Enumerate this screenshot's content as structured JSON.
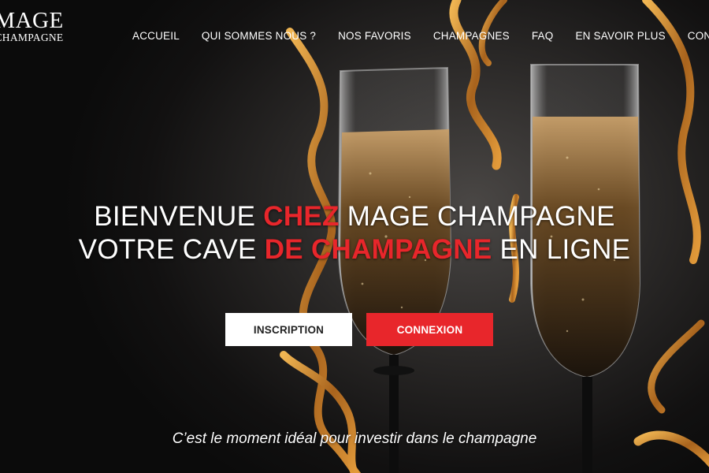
{
  "logo": {
    "line1": "MAGE",
    "line2": "CHAMPAGNE"
  },
  "nav": {
    "items": [
      "ACCUEIL",
      "QUI SOMMES NOUS ?",
      "NOS FAVORIS",
      "CHAMPAGNES",
      "FAQ",
      "EN SAVOIR PLUS",
      "CONTACT"
    ]
  },
  "hero": {
    "line1": {
      "a": "BIENVENUE ",
      "b": "CHEZ",
      "c": " MAGE CHAMPAGNE"
    },
    "line2": {
      "a": "VOTRE CAVE ",
      "b": "DE CHAMPAGNE",
      "c": " EN LIGNE"
    },
    "btn_inscription": "INSCRIPTION",
    "btn_connexion": "CONNEXION",
    "tagline": "C’est le moment idéal pour investir dans le champagne"
  },
  "colors": {
    "accent": "#e8262b",
    "ribbon": "#c98a32"
  }
}
